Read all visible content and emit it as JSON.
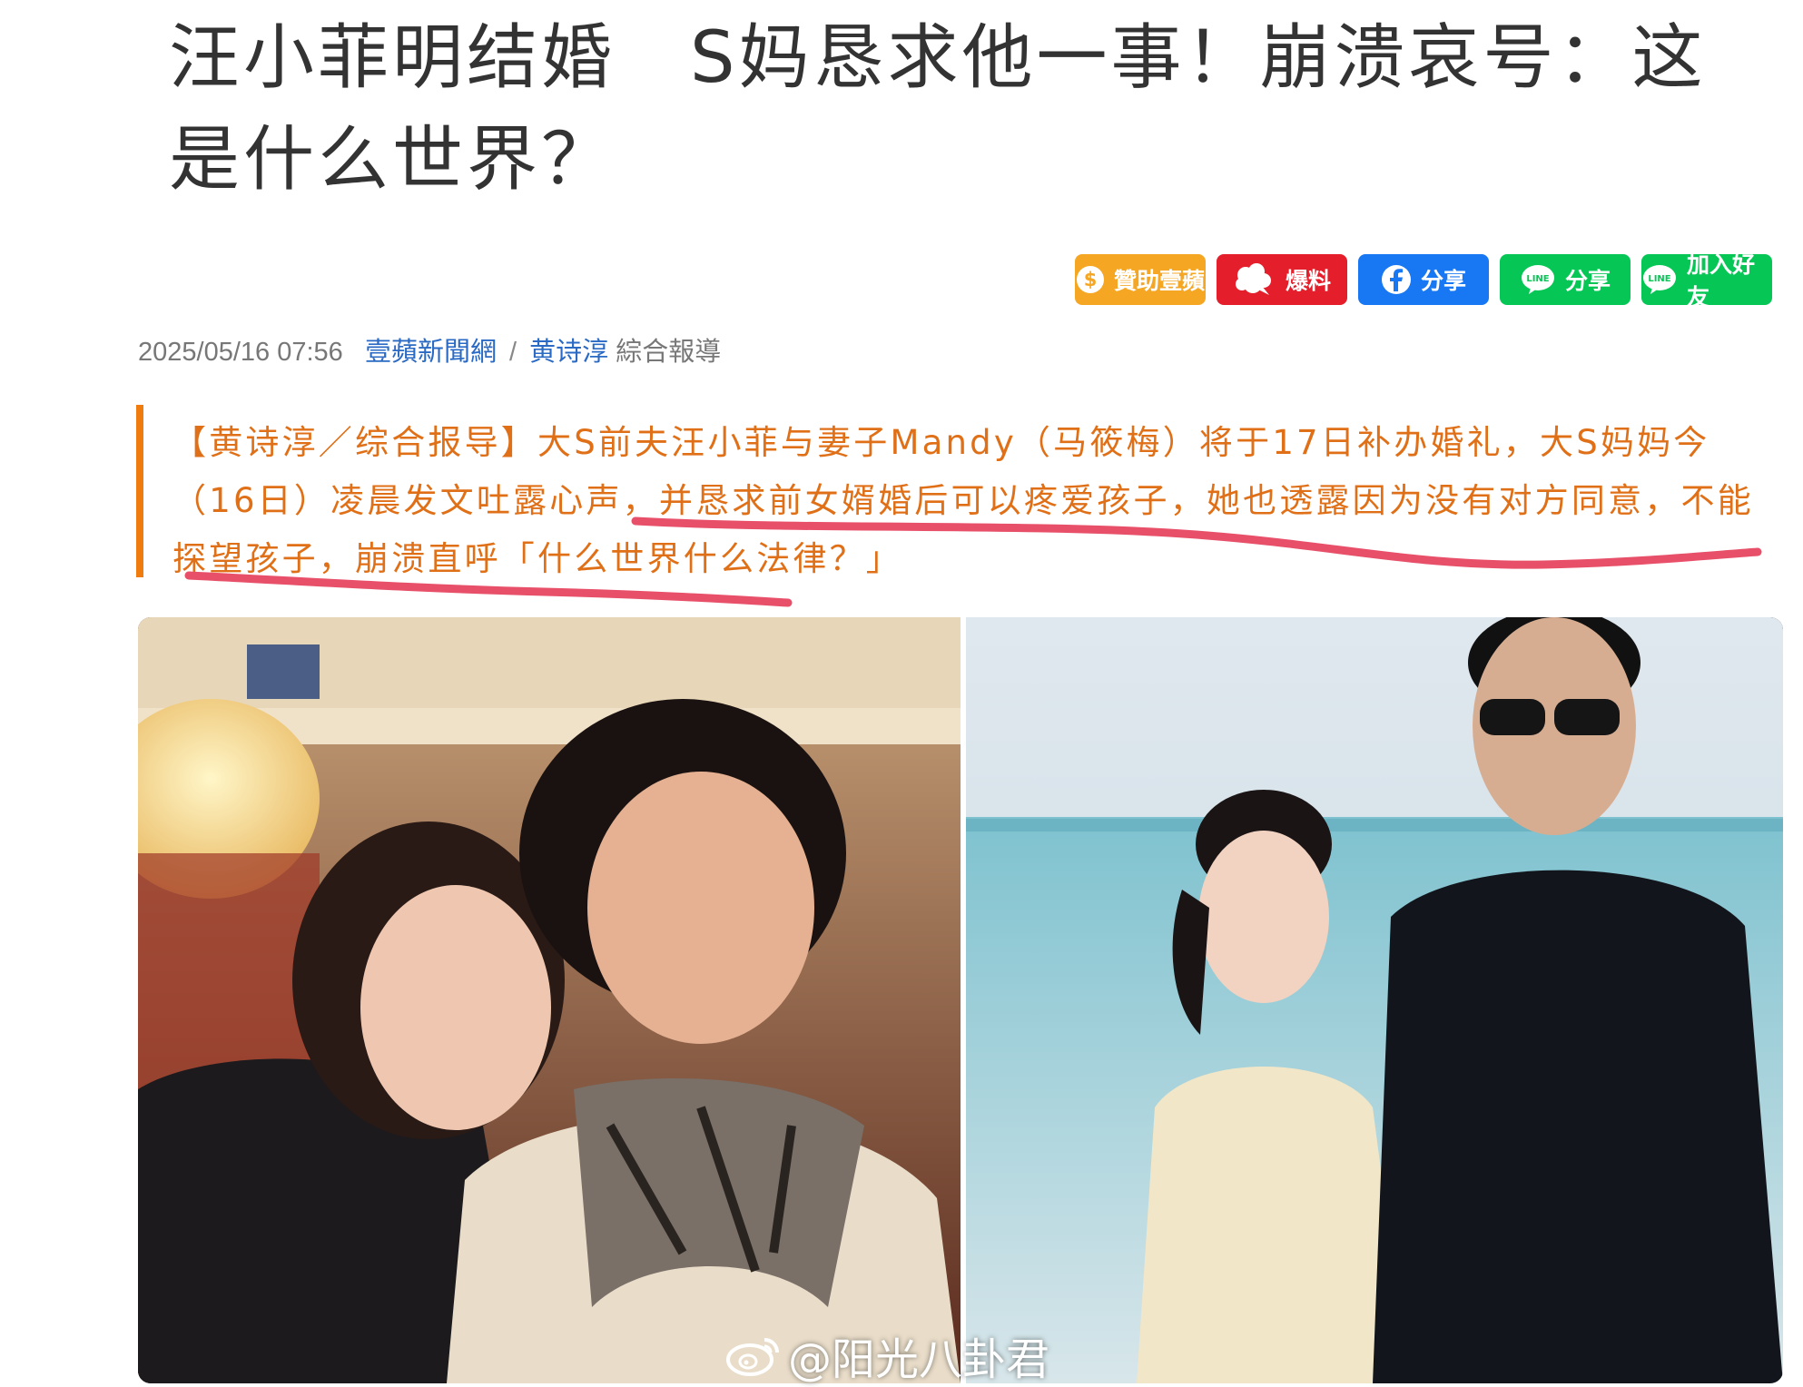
{
  "article": {
    "title": "汪小菲明结婚　S妈恳求他一事！崩溃哀号：这是什么世界？",
    "share_buttons": [
      {
        "label": "贊助壹蘋",
        "icon": "dollar-coin-icon",
        "color": "#f5a623"
      },
      {
        "label": "爆料",
        "icon": "flower-blast-icon",
        "color": "#e41e2a"
      },
      {
        "label": "分享",
        "icon": "facebook-icon",
        "color": "#1877f2"
      },
      {
        "label": "分享",
        "icon": "line-icon",
        "color": "#06c755"
      },
      {
        "label": "加入好友",
        "icon": "line-icon",
        "color": "#06c755"
      }
    ],
    "meta": {
      "datetime": "2025/05/16 07:56",
      "source": "壹蘋新聞網",
      "separator": "/",
      "author": "黄诗淳",
      "type": "綜合報導"
    },
    "lead": "【黄诗淳／综合报导】大S前夫汪小菲与妻子Mandy（马筱梅）将于17日补办婚礼，大S妈妈今（16日）凌晨发文吐露心声，并恳求前女婿婚后可以疼爱孩子，她也透露因为没有对方同意，不能探望孩子，崩溃直呼「什么世界什么法律？」",
    "photo": {
      "watermark": "@阳光八卦君",
      "watermark_icon": "weibo-icon"
    }
  },
  "colors": {
    "title": "#333333",
    "lead_text": "#e07018",
    "lead_border": "#f07c10",
    "link": "#2a6ac4",
    "marker": "#e8506a"
  }
}
